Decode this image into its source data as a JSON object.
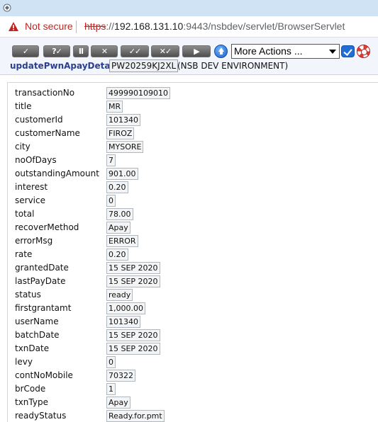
{
  "browser": {
    "security_label": "Not secure",
    "url_scheme": "https",
    "url_rest_prefix": "://",
    "url_host": "192.168.131.10",
    "url_path": ":9443/nsbdev/servlet/BrowserServlet"
  },
  "toolbar": {
    "buttons": [
      {
        "label": "✓",
        "icon": "validate-icon"
      },
      {
        "label": "?✓",
        "icon": "verify-icon"
      },
      {
        "label": "II",
        "icon": "hold-icon"
      },
      {
        "label": "✕",
        "icon": "delete-icon"
      },
      {
        "label": "✓✓",
        "icon": "authorise-icon"
      },
      {
        "label": "✕✓",
        "icon": "reverse-icon"
      },
      {
        "label": "▶",
        "icon": "next-icon"
      }
    ],
    "more_actions": "More Actions ...",
    "screen_name": "updatePwnApayDetails",
    "record_id": "PW20259KJ2XL",
    "environment": "(NSB DEV ENVIRONMENT)"
  },
  "record": {
    "fields": [
      {
        "label": "transactionNo",
        "value": "499990109010"
      },
      {
        "label": "title",
        "value": "MR"
      },
      {
        "label": "customerId",
        "value": "101340"
      },
      {
        "label": "customerName",
        "value": "FIROZ"
      },
      {
        "label": "city",
        "value": "MYSORE"
      },
      {
        "label": "noOfDays",
        "value": "7"
      },
      {
        "label": "outstandingAmount",
        "value": "901.00"
      },
      {
        "label": "interest",
        "value": "0.20"
      },
      {
        "label": "service",
        "value": "0"
      },
      {
        "label": "total",
        "value": "78.00"
      },
      {
        "label": "recoverMethod",
        "value": "Apay"
      },
      {
        "label": "errorMsg",
        "value": "ERROR"
      },
      {
        "label": "rate",
        "value": "0.20"
      },
      {
        "label": "grantedDate",
        "value": "15 SEP 2020"
      },
      {
        "label": "lastPayDate",
        "value": "15 SEP 2020"
      },
      {
        "label": "status",
        "value": "ready"
      },
      {
        "label": "firstgrantamt",
        "value": "1,000.00"
      },
      {
        "label": "userName",
        "value": "101340"
      },
      {
        "label": "batchDate",
        "value": "15 SEP 2020"
      },
      {
        "label": "txnDate",
        "value": "15 SEP 2020"
      },
      {
        "label": "levy",
        "value": "0"
      },
      {
        "label": "contNoMobile",
        "value": "70322"
      },
      {
        "label": "brCode",
        "value": "1"
      },
      {
        "label": "txnType",
        "value": "Apay"
      },
      {
        "label": "readyStatus",
        "value": "Ready.for.pmt"
      }
    ]
  }
}
